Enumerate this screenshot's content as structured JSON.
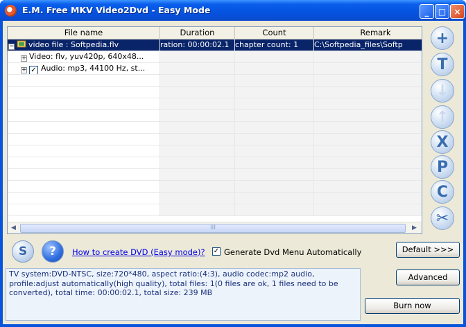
{
  "window": {
    "title": "E.M. Free MKV Video2Dvd - Easy Mode",
    "controls": {
      "minimize": "_",
      "maximize": "□",
      "close": "×"
    }
  },
  "grid": {
    "columns": [
      "File name",
      "Duration",
      "Count",
      "Remark"
    ],
    "rows": [
      {
        "name": "video file : Softpedia.flv",
        "duration": "ration: 00:00:02.1",
        "count": "chapter count: 1",
        "remark": "C:\\Softpedia_files\\Softp",
        "expander": "−",
        "selected": true
      },
      {
        "name": "Video: flv, yuv420p, 640x48...",
        "duration": "",
        "count": "",
        "remark": "",
        "expander": "+",
        "selected": false
      },
      {
        "name": "Audio: mp3, 44100 Hz, st...",
        "duration": "",
        "count": "",
        "remark": "",
        "expander": "+",
        "checked": true,
        "selected": false
      }
    ],
    "scroll_grip": "III"
  },
  "toolbar": {
    "add_icon": "+",
    "title_icon": "T",
    "move_down_icon": "↓",
    "move_up_icon": "↑",
    "remove_icon": "X",
    "p_icon": "P",
    "c_icon": "C",
    "cut_icon": "✂"
  },
  "bottom": {
    "s_label": "S",
    "help_label": "?",
    "how_to_link": "How to create DVD (Easy mode)?",
    "generate_menu_label": "Generate Dvd Menu Automatically",
    "generate_menu_checked": true,
    "default_button": "Default >>>",
    "advanced_button": "Advanced",
    "burn_button": "Burn now",
    "info_text": "TV system:DVD-NTSC, size:720*480, aspect ratio:(4:3), audio codec:mp2 audio, profile:adjust automatically(high quality), total files: 1(0 files are ok, 1 files need to be converted), total time: 00:00:02.1, total size: 239 MB"
  }
}
